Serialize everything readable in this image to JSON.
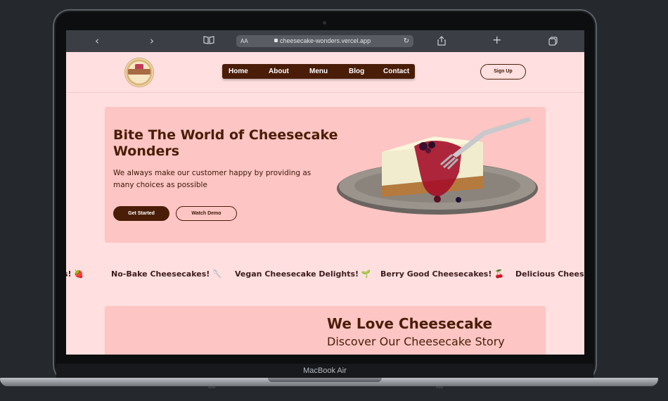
{
  "device": {
    "label": "MacBook Air"
  },
  "browser": {
    "back_icon": "‹",
    "forward_icon": "›",
    "aa_label": "AA",
    "url": "cheesecake-wonders.vercel.app",
    "reload_icon": "↻",
    "share_icon": "⇪",
    "new_tab_icon": "+",
    "tabs_icon": "⧉",
    "bookmarks_icon": "📖"
  },
  "site": {
    "logo_text": "CHEESECAKE",
    "nav": [
      "Home",
      "About",
      "Menu",
      "Blog",
      "Contact"
    ],
    "signup_label": "Sign Up"
  },
  "hero": {
    "title": "Bite The World of Cheesecake Wonders",
    "subtitle": "We always make our customer happy by providing as many choices as possible",
    "primary_button": "Get Started",
    "secondary_button": "Watch Demo"
  },
  "marquee": [
    {
      "text": "s!",
      "icon": "🍓"
    },
    {
      "text": "No-Bake Cheesecakes!",
      "icon": "🥄"
    },
    {
      "text": "Vegan Cheesecake Delights!",
      "icon": "🌱"
    },
    {
      "text": "Berry Good Cheesecakes!",
      "icon": "🍒"
    },
    {
      "text": "Delicious Cheeseca",
      "icon": ""
    }
  ],
  "about": {
    "title": "We Love Cheesecake",
    "subtitle": "Discover Our Cheesecake Story"
  },
  "colors": {
    "page_bg": "#ffdfdf",
    "card_bg": "#fdc5c3",
    "brand_brown": "#4a1d08"
  }
}
